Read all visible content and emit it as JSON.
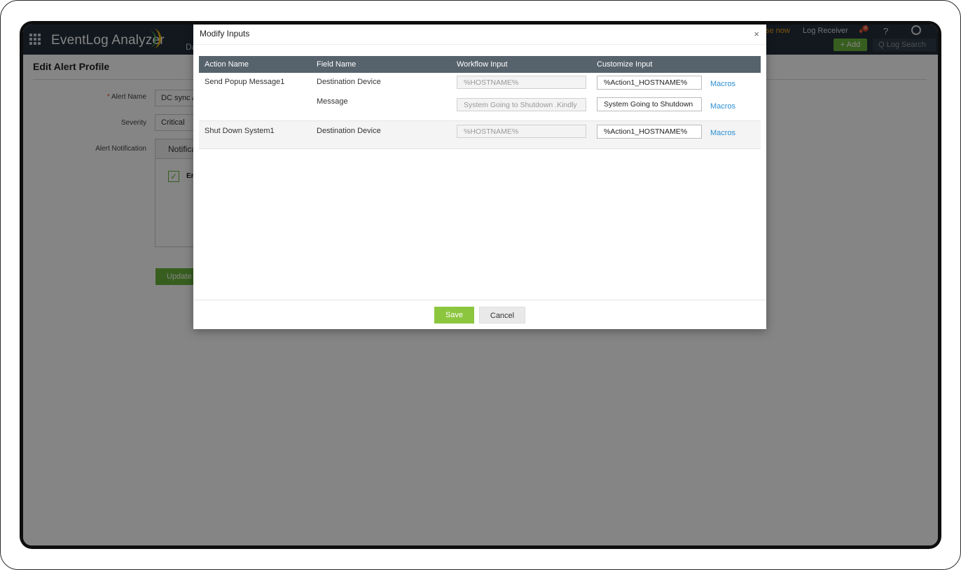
{
  "app": {
    "logo_text": "EventLog Analyzer",
    "nav_peek": "Da",
    "license_link": "se now",
    "log_receiver": "Log Receiver",
    "notification_count": "4",
    "help": "?",
    "add_label": "+ Add",
    "search_placeholder": "Q  Log Search"
  },
  "page": {
    "title": "Edit Alert Profile",
    "alert_name_label": "Alert Name",
    "alert_name_value": "DC sync A",
    "severity_label": "Severity",
    "severity_value": "Critical",
    "alert_notification_label": "Alert Notification",
    "notification_tab": "Notifica",
    "notification_check_label": "Er",
    "update_button": "Update"
  },
  "modal": {
    "title": "Modify Inputs",
    "close": "×",
    "columns": [
      "Action Name",
      "Field Name",
      "Workflow Input",
      "Customize Input"
    ],
    "rows": [
      {
        "action_name": "Send Popup Message1",
        "fields": [
          {
            "field_name": "Destination Device",
            "workflow_input": "%HOSTNAME%",
            "customize_input": "%Action1_HOSTNAME%",
            "macros": "Macros"
          },
          {
            "field_name": "Message",
            "workflow_input": "System Going to Shutdown .Kindly",
            "customize_input": "System Going to Shutdown",
            "macros": "Macros"
          }
        ]
      },
      {
        "action_name": "Shut Down System1",
        "fields": [
          {
            "field_name": "Destination Device",
            "workflow_input": "%HOSTNAME%",
            "customize_input": "%Action1_HOSTNAME%",
            "macros": "Macros"
          }
        ]
      }
    ],
    "save_label": "Save",
    "cancel_label": "Cancel"
  },
  "colors": {
    "header_bg": "#232f3a",
    "table_header_bg": "#56626c",
    "save_green": "#8cc63f",
    "link_blue": "#2a8fd4"
  }
}
